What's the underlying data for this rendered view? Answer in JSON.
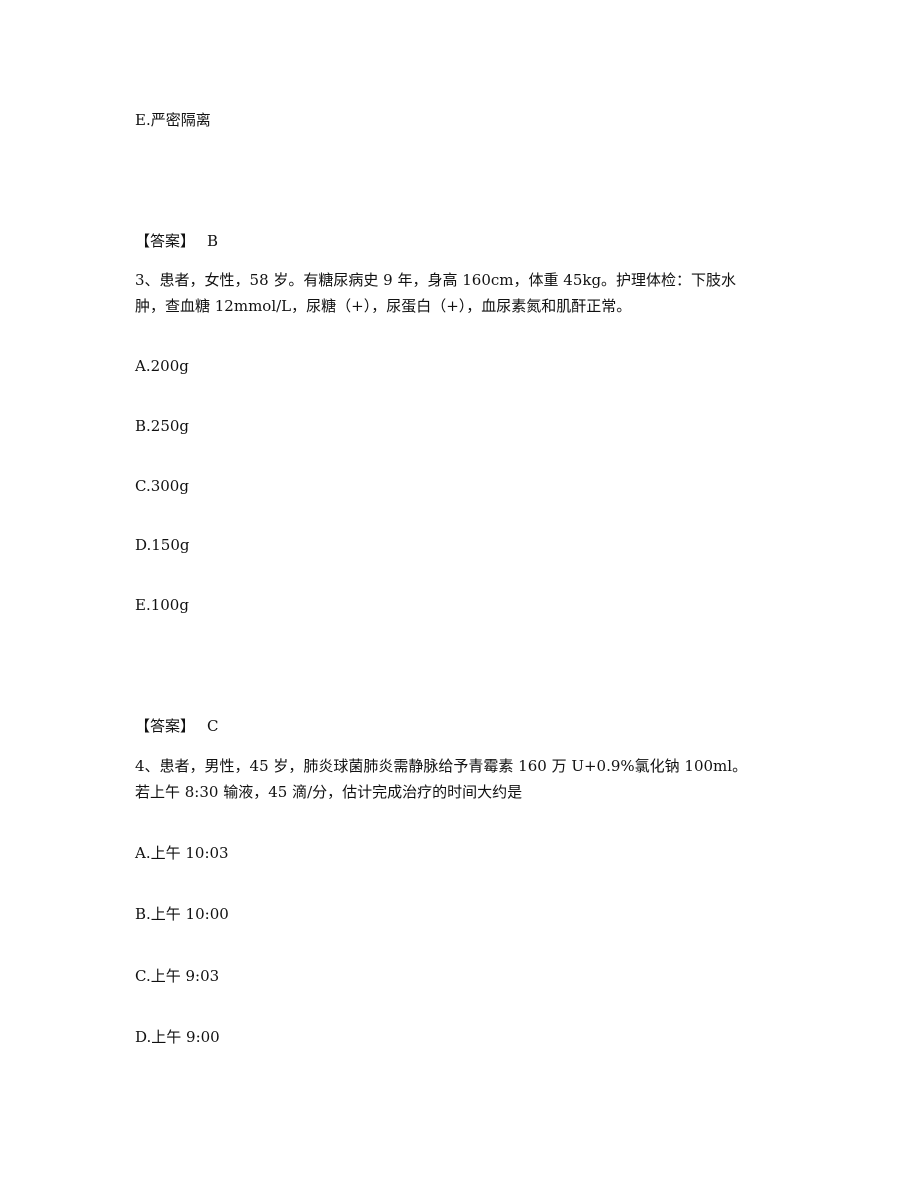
{
  "prev_question": {
    "last_option": "E.严密隔离",
    "answer_label": "【答案】",
    "answer_value": "B"
  },
  "question3": {
    "stem_line1": "3、患者，女性，58 岁。有糖尿病史 9 年，身高 160cm，体重 45kg。护理体检：下肢水",
    "stem_line2": "肿，查血糖 12mmol/L，尿糖（+），尿蛋白（+），血尿素氮和肌酐正常。",
    "options": [
      {
        "label": "A.200g"
      },
      {
        "label": "B.250g"
      },
      {
        "label": "C.300g"
      },
      {
        "label": "D.150g"
      },
      {
        "label": "E.100g"
      }
    ],
    "answer_label": "【答案】",
    "answer_value": "C"
  },
  "question4": {
    "stem_line1": "4、患者，男性，45 岁，肺炎球菌肺炎需静脉给予青霉素 160 万 U+0.9%氯化钠 100ml。",
    "stem_line2": "若上午 8:30 输液，45 滴/分，估计完成治疗的时间大约是",
    "options": [
      {
        "label": "A.上午 10:03"
      },
      {
        "label": "B.上午 10:00"
      },
      {
        "label": "C.上午 9:03"
      },
      {
        "label": "D.上午 9:00"
      }
    ]
  }
}
